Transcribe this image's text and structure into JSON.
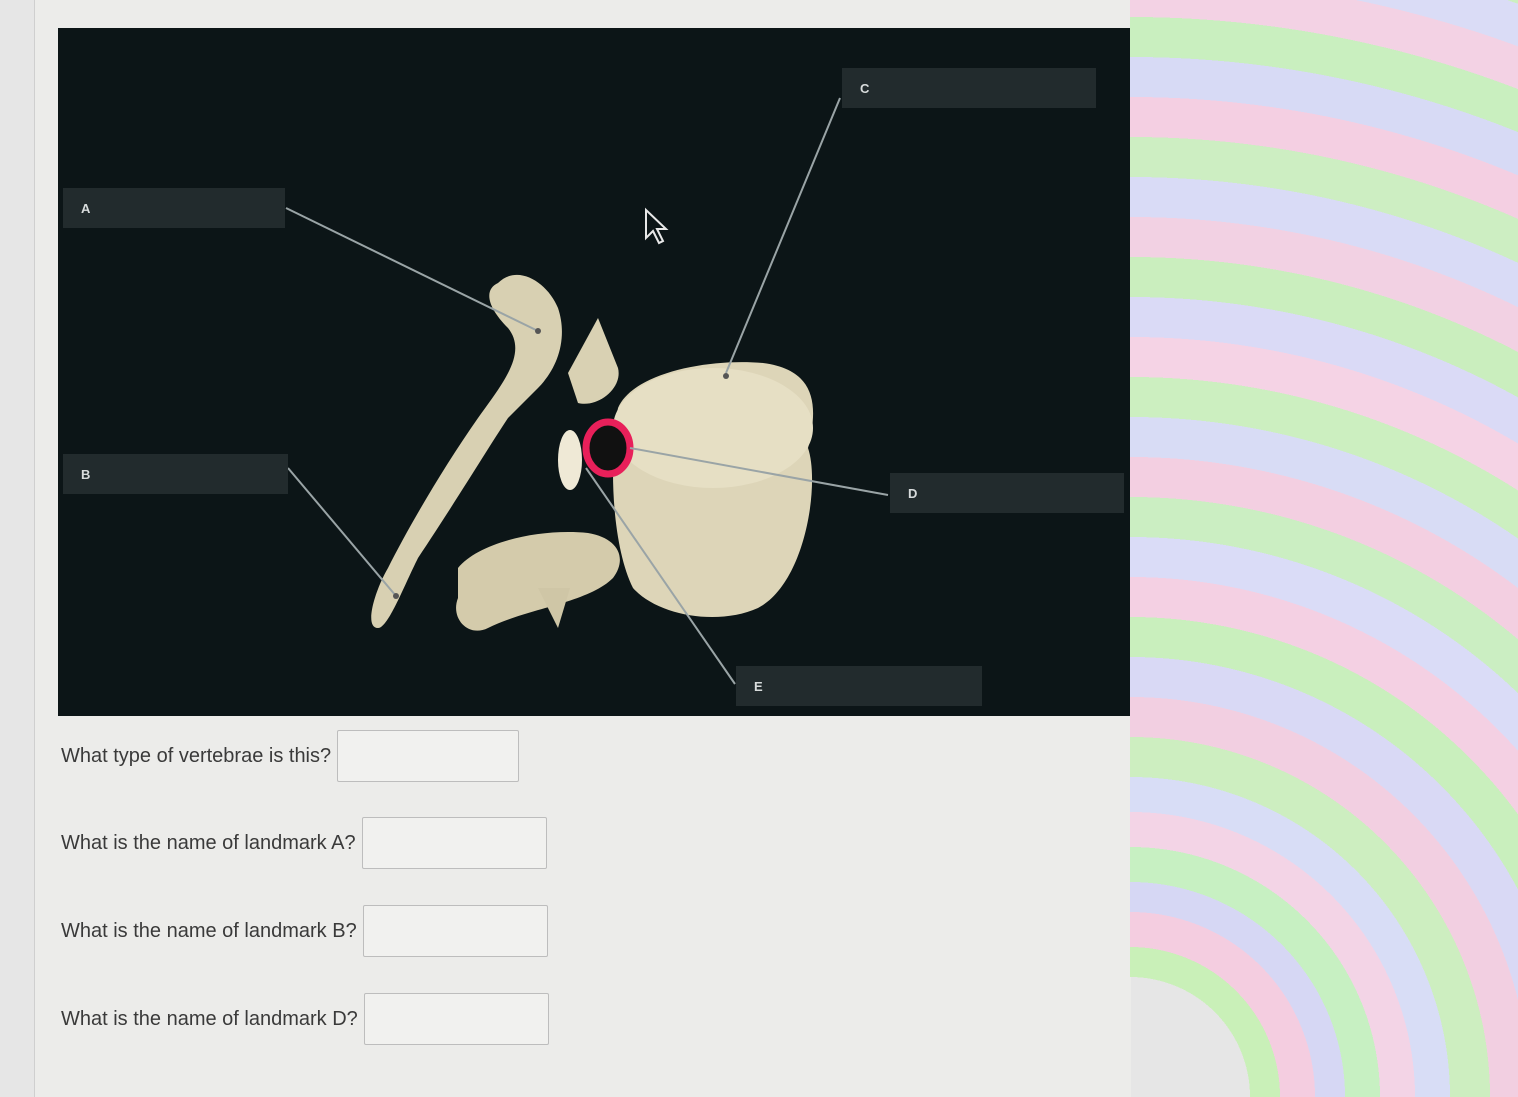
{
  "diagram": {
    "labels": [
      {
        "id": "A",
        "text": "A"
      },
      {
        "id": "B",
        "text": "B"
      },
      {
        "id": "C",
        "text": "C"
      },
      {
        "id": "D",
        "text": "D"
      },
      {
        "id": "E",
        "text": "E"
      }
    ],
    "highlight_color": "#e8205a"
  },
  "questions": [
    {
      "text": "What type of vertebrae is this?",
      "value": ""
    },
    {
      "text": "What is the name of landmark A?",
      "value": ""
    },
    {
      "text": "What is the name of landmark B?",
      "value": ""
    },
    {
      "text": "What is the name of landmark D?",
      "value": ""
    }
  ],
  "icons": {
    "cursor": "mouse-pointer-icon"
  }
}
